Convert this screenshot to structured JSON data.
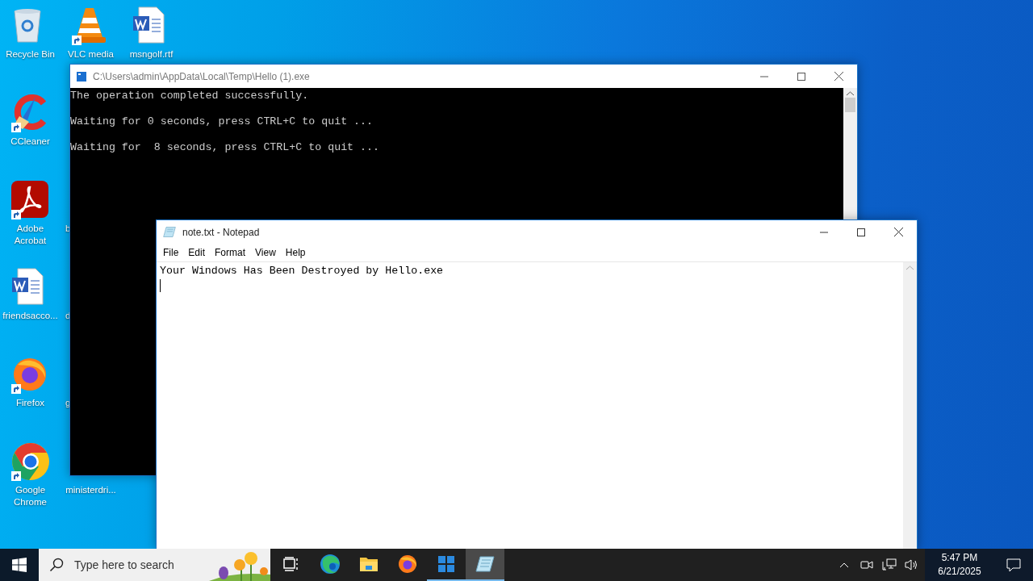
{
  "desktop": {
    "columns": [
      [
        {
          "label": "Recycle Bin",
          "kind": "recycle",
          "shortcut": false
        },
        {
          "label": "CCleaner",
          "kind": "ccleaner",
          "shortcut": true
        },
        {
          "label": "Adobe Acrobat",
          "kind": "acrobat",
          "shortcut": true
        },
        {
          "label": "friendsacco...",
          "kind": "word",
          "shortcut": false
        },
        {
          "label": "Firefox",
          "kind": "firefox",
          "shortcut": true
        },
        {
          "label": "Google Chrome",
          "kind": "chrome",
          "shortcut": true
        }
      ],
      [
        {
          "label": "VLC media",
          "kind": "vlc",
          "shortcut": true
        },
        {
          "label": "b",
          "kind": "cut",
          "shortcut": false
        },
        {
          "label": "d",
          "kind": "cut",
          "shortcut": false
        },
        {
          "label": "g",
          "kind": "cut",
          "shortcut": false
        },
        {
          "label": "ministerdri...",
          "kind": "hidden",
          "shortcut": false
        }
      ],
      [
        {
          "label": "msngolf.rtf",
          "kind": "word",
          "shortcut": false
        }
      ]
    ]
  },
  "console": {
    "title": "C:\\Users\\admin\\AppData\\Local\\Temp\\Hello (1).exe",
    "lines": [
      "The operation completed successfully.",
      "Waiting for 0 seconds, press CTRL+C to quit ...",
      "Waiting for  8 seconds, press CTRL+C to quit ..."
    ]
  },
  "notepad": {
    "title": "note.txt - Notepad",
    "menu": [
      "File",
      "Edit",
      "Format",
      "View",
      "Help"
    ],
    "text": "Your Windows Has Been Destroyed by Hello.exe"
  },
  "taskbar": {
    "search": {
      "placeholder": "Type here to search"
    },
    "apps": [
      {
        "kind": "taskview",
        "running": false,
        "selected": false
      },
      {
        "kind": "edge",
        "running": false,
        "selected": false
      },
      {
        "kind": "explorer",
        "running": false,
        "selected": false
      },
      {
        "kind": "firefox",
        "running": false,
        "selected": false
      },
      {
        "kind": "console",
        "running": true,
        "selected": false
      },
      {
        "kind": "notepad",
        "running": true,
        "selected": true
      }
    ],
    "time": "5:47 PM",
    "date": "6/21/2025"
  }
}
